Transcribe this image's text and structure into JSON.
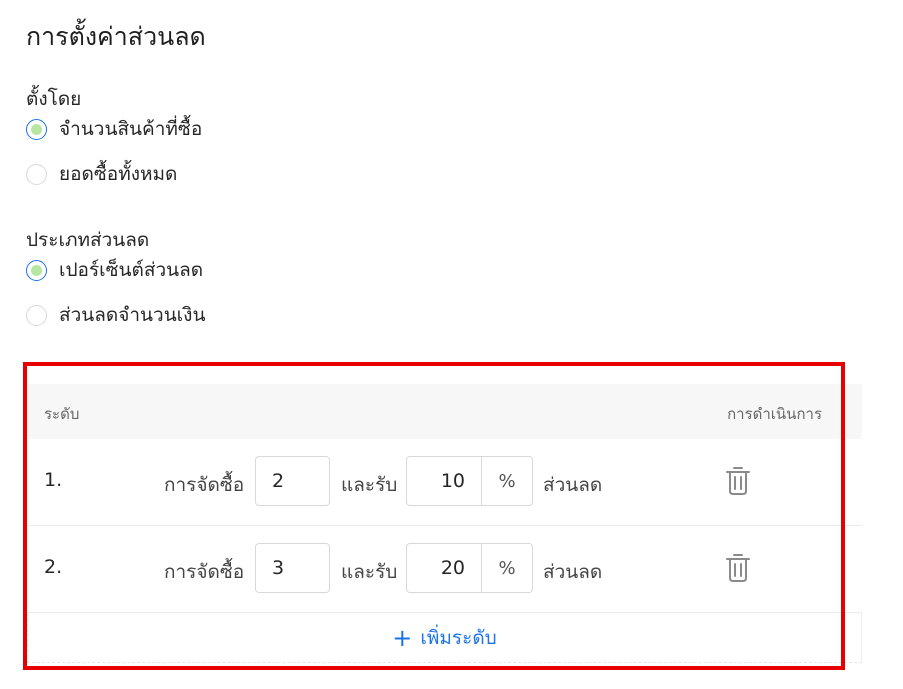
{
  "title": "การตั้งค่าส่วนลด",
  "set_by": {
    "label": "ตั้งโดย",
    "options": [
      {
        "label": "จำนวนสินค้าที่ซื้อ",
        "checked": true
      },
      {
        "label": "ยอดซื้อทั้งหมด",
        "checked": false
      }
    ]
  },
  "discount_type": {
    "label": "ประเภทส่วนลด",
    "options": [
      {
        "label": "เปอร์เซ็นต์ส่วนลด",
        "checked": true
      },
      {
        "label": "ส่วนลดจำนวนเงิน",
        "checked": false
      }
    ]
  },
  "table": {
    "col_level": "ระดับ",
    "col_action": "การดำเนินการ",
    "rows": [
      {
        "index": "1.",
        "buy_label": "การจัดซื้อ",
        "quantity": "2",
        "get_label": "และรับ",
        "discount": "10",
        "unit": "%",
        "suffix": "ส่วนลด"
      },
      {
        "index": "2.",
        "buy_label": "การจัดซื้อ",
        "quantity": "3",
        "get_label": "และรับ",
        "discount": "20",
        "unit": "%",
        "suffix": "ส่วนลด"
      }
    ],
    "add_label": "เพิ่มระดับ",
    "add_icon": "+"
  },
  "colors": {
    "accent": "#1a73e8",
    "highlight": "#e60000",
    "radio_fill": "#b7e6a3"
  }
}
